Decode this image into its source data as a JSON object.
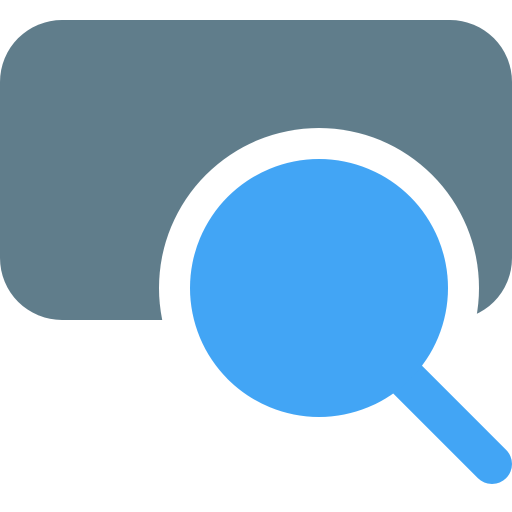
{
  "icon": {
    "name": "search-window-icon",
    "colors": {
      "panel": "#607D8B",
      "magnifier": "#42A5F5",
      "background": "#FFFFFF"
    }
  }
}
